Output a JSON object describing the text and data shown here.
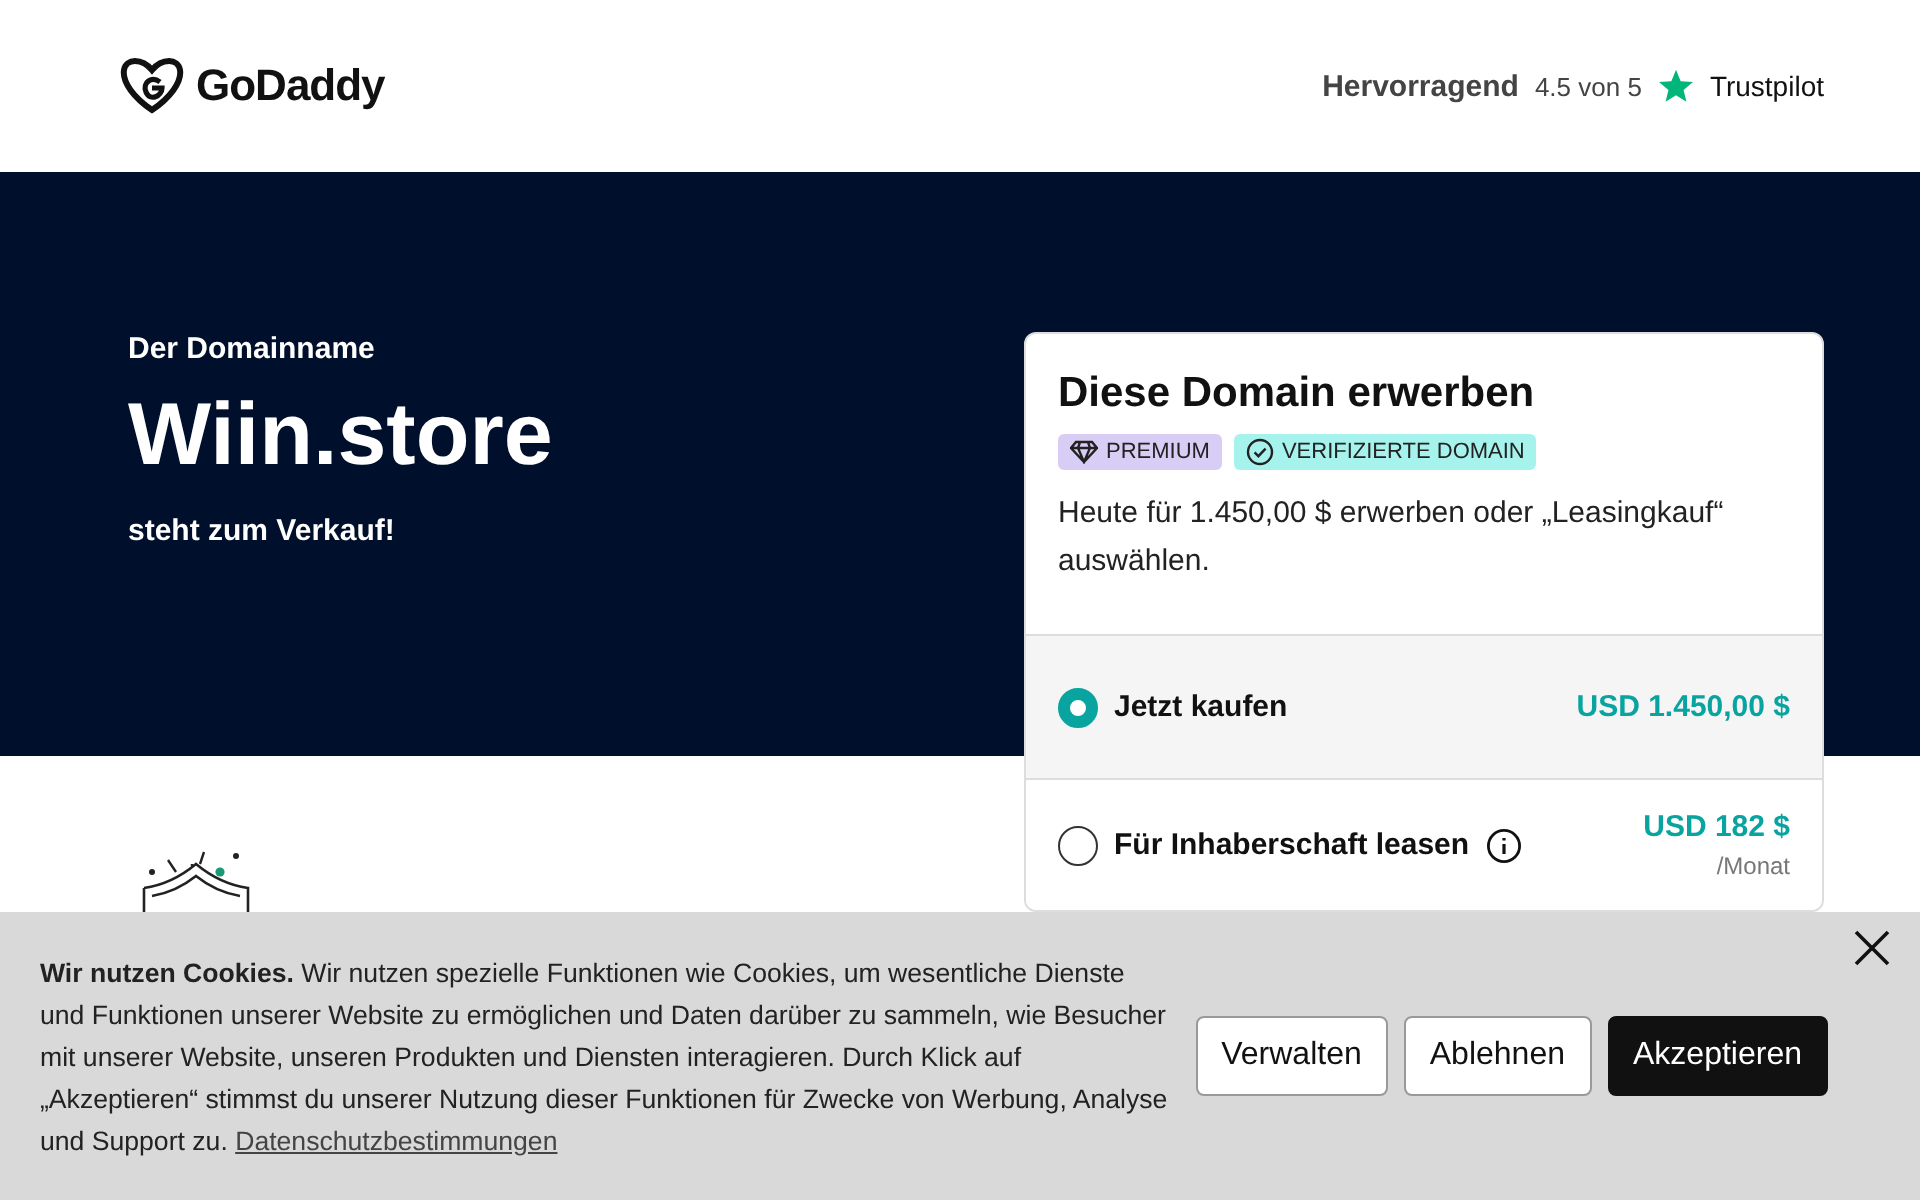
{
  "header": {
    "logo": "GoDaddy",
    "rating_label": "Hervorragend",
    "rating_score": "4.5 von 5",
    "review_site": "Trustpilot"
  },
  "hero": {
    "eyebrow": "Der Domainname",
    "domain": "Wiin.store",
    "tagline": "steht zum Verkauf!"
  },
  "purchase_card": {
    "title": "Diese Domain erwerben",
    "badges": [
      {
        "kind": "premium",
        "label": "PREMIUM",
        "color": "#d8cdf5"
      },
      {
        "kind": "verified",
        "label": "VERIFIZIERTE DOMAIN",
        "color": "#a6f2ec"
      }
    ],
    "description": "Heute für 1.450,00 $ erwerben oder „Leasingkauf“ auswählen.",
    "options": [
      {
        "label": "Jetzt kaufen",
        "price": "USD 1.450,00 $",
        "selected": true,
        "info": false
      },
      {
        "label": "Für Inhaberschaft leasen",
        "price": "USD 182 $",
        "period": "/Monat",
        "selected": false,
        "info": true
      }
    ]
  },
  "cookie_banner": {
    "heading": "Wir nutzen Cookies.",
    "text": "Wir nutzen spezielle Funktionen wie Cookies, um wesentliche Dienste und Funktionen unserer Website zu ermöglichen und Daten darüber zu sammeln, wie Besucher mit unserer Website, unseren Produkten und Diensten interagieren. Durch Klick auf „Akzeptieren“ stimmst du unserer Nutzung dieser Funktionen für Zwecke von Werbung, Analyse und Support zu.",
    "link": "Datenschutzbestimmungen",
    "buttons": [
      {
        "kind": "secondary",
        "label": "Verwalten"
      },
      {
        "kind": "secondary",
        "label": "Ablehnen"
      },
      {
        "kind": "primary",
        "label": "Akzeptieren"
      }
    ]
  }
}
